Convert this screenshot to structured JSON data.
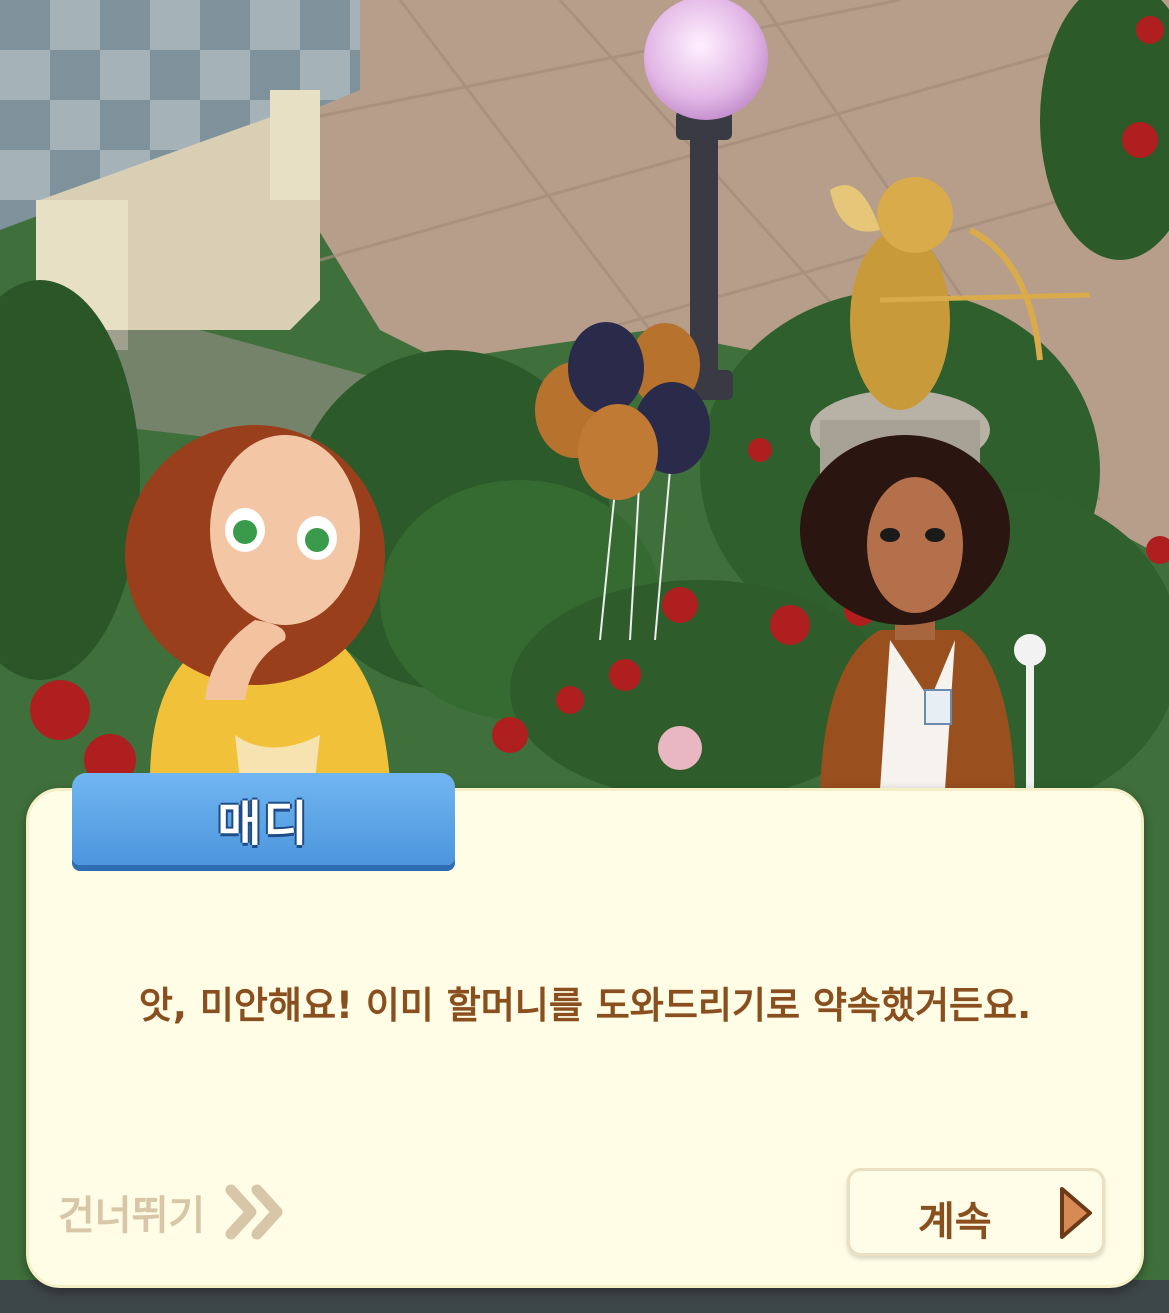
{
  "dialog": {
    "speaker": "매디",
    "text": "앗, 미안해요! 이미 할머니를 도와드리기로 약속했거든요."
  },
  "controls": {
    "skip_label": "건너뛰기",
    "continue_label": "계속"
  },
  "colors": {
    "dialog_bg": "#fffde5",
    "name_tab": "#5aa3e6",
    "text_brown": "#8a4f1e",
    "skip_gray": "#d8c6a8",
    "play_orange": "#d88a55"
  }
}
